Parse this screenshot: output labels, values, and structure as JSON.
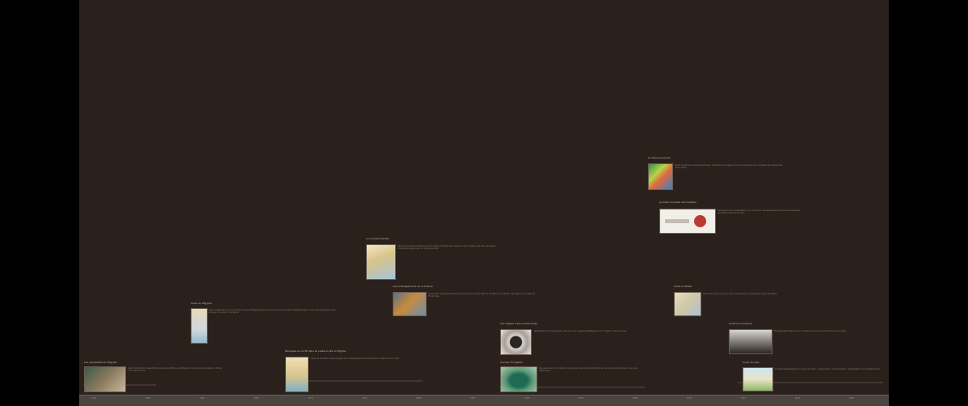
{
  "cards": [
    {
      "title": "Les précipitations d'Égypte",
      "text": "Carte montrant la répartition des précipitations en Égypte et le long de la vallée du Nil au cours de l'année."
    },
    {
      "title": "Carte de l'Égypte",
      "text": "Carte illustrant le cours du Nil à travers l'Égypte depuis Assouan jusqu'au delta méditerranéen, avec les principales villes et oasis du désert occidental."
    },
    {
      "title": "Barrages sur le Nil dans la vallée du Nil en Égypte",
      "text": "Carte de situation des barrages et aménagements hydrauliques construits sur le Nil."
    },
    {
      "title": "Le Croissant fertile",
      "text": "Carte du Croissant fertile entre le Tigre et l'Euphrate, berceau de l'irrigation et des premières civilisations agricoles du Proche-Orient."
    },
    {
      "title": "Les aménagements de la Turquie",
      "text": "Carte des aménagements hydrauliques du projet GAP en Anatolie du Sud-Est, barrages sur le Tigre et l'Euphrate."
    },
    {
      "title": "Les nappes d'eau souterraines",
      "text": "Illustration d'un forage de puits vers une nappe phréatique pour l'irrigation des cultures."
    },
    {
      "title": "Cercles d'irrigation",
      "text": "Vue aérienne d'un champ irrigué par pivot central formant un cercle de culture dans une zone désertique."
    },
    {
      "title": "Le stress hydrique",
      "text": "Carte mondiale du stress hydrique montrant les régions où la demande en eau dépasse les ressources disponibles."
    },
    {
      "title": "Journée mondiale des toilettes",
      "text": "Campagne de sensibilisation sur l'accès à l'assainissement et aux installations sanitaires dans le monde."
    },
    {
      "title": "Carte du Brésil",
      "text": "Carte des ressources en eau et des bassins hydrographiques du Brésil."
    },
    {
      "title": "Le fleuve Amazone",
      "text": "Photographie des rives de l'Amazone et de la forêt tropicale humide."
    },
    {
      "title": "Cycle de l'eau",
      "text": "Schéma pédagogique du cycle de l'eau : évaporation, condensation, précipitations et ruissellement."
    }
  ],
  "axis": {
    "ticks": [
      "1950",
      "1955",
      "1960",
      "1965",
      "1970",
      "1975",
      "1980",
      "1985",
      "1990",
      "1995",
      "2000",
      "2005",
      "2010",
      "2015",
      "2020"
    ]
  },
  "colors": {
    "stage": "#2a211d",
    "frame": "#000000",
    "axis": "#4a4541"
  }
}
